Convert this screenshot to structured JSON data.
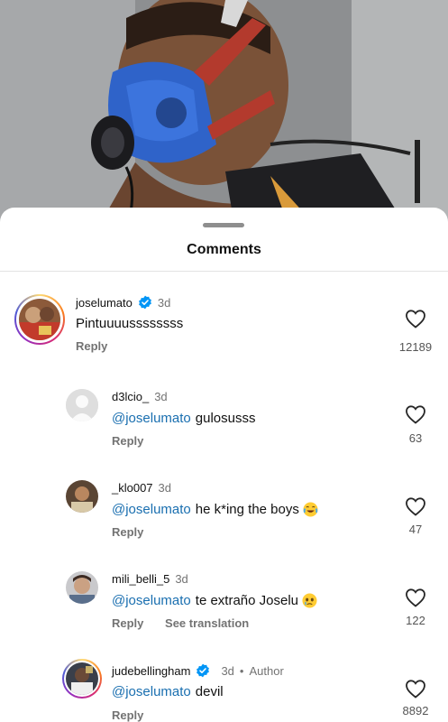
{
  "sheet": {
    "title": "Comments"
  },
  "comments": [
    {
      "username": "joselumato",
      "verified": true,
      "time": "3d",
      "author": "",
      "mention": "",
      "text": "Pintuuuussssssss",
      "emoji": "",
      "actions": [
        "Reply"
      ],
      "likes": "12189"
    },
    {
      "username": "d3lcio_",
      "verified": false,
      "time": "3d",
      "author": "",
      "mention": "@joselumato",
      "text": "gulosusss",
      "emoji": "",
      "actions": [
        "Reply"
      ],
      "likes": "63"
    },
    {
      "username": "_klo007",
      "verified": false,
      "time": "3d",
      "author": "",
      "mention": "@joselumato",
      "text": "he k*ing the boys",
      "emoji": "face-with-tears-of-joy",
      "actions": [
        "Reply"
      ],
      "likes": "47"
    },
    {
      "username": "mili_belli_5",
      "verified": false,
      "time": "3d",
      "author": "",
      "mention": "@joselumato",
      "text": "te extraño Joselu",
      "emoji": "face-holding-back-tears",
      "actions": [
        "Reply",
        "See translation"
      ],
      "likes": "122"
    },
    {
      "username": "judebellingham",
      "verified": true,
      "time": "3d",
      "author": "Author",
      "mention": "@joselumato",
      "text": "devil",
      "emoji": "",
      "actions": [
        "Reply"
      ],
      "likes": "8892"
    }
  ],
  "colors": {
    "mention": "#1a6fb0",
    "verified": "#0095f6",
    "secondary": "#737373"
  }
}
